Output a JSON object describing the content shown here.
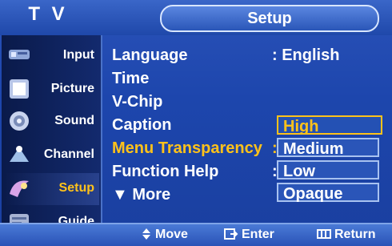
{
  "header": {
    "tv_title": "T V",
    "section_title": "Setup"
  },
  "sidebar": {
    "items": [
      {
        "label": "Input",
        "icon": "input-icon"
      },
      {
        "label": "Picture",
        "icon": "picture-icon"
      },
      {
        "label": "Sound",
        "icon": "sound-icon"
      },
      {
        "label": "Channel",
        "icon": "channel-icon"
      },
      {
        "label": "Setup",
        "icon": "setup-icon",
        "active": true
      },
      {
        "label": "Guide",
        "icon": "guide-icon"
      }
    ]
  },
  "menu": {
    "items": [
      {
        "label": "Language",
        "value": ": English"
      },
      {
        "label": "Time",
        "value": ""
      },
      {
        "label": "V-Chip",
        "value": ""
      },
      {
        "label": "Caption",
        "value": ""
      },
      {
        "label": "Menu Transparency",
        "value": ":",
        "highlighted": true
      },
      {
        "label": "Function Help",
        "value": ":"
      },
      {
        "label": "▼ More",
        "value": ""
      }
    ]
  },
  "dropdown": {
    "options": [
      "High",
      "Medium",
      "Low",
      "Opaque"
    ],
    "selected": "High"
  },
  "footer": {
    "move": "Move",
    "enter": "Enter",
    "return": "Return"
  },
  "colors": {
    "highlight": "#ffc21a",
    "background": "#1d46ad",
    "sidebar": "#0a1a4a"
  }
}
